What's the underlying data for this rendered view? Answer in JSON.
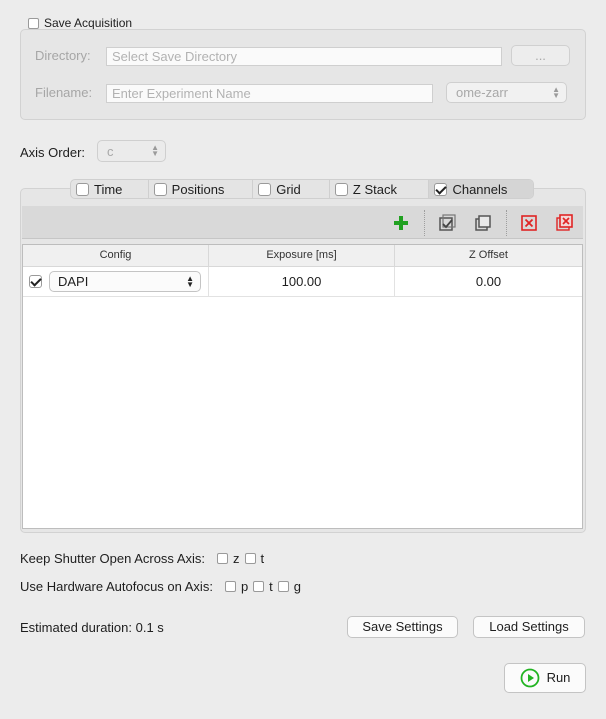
{
  "save_acquisition": {
    "label": "Save Acquisition",
    "checked": false,
    "directory_label": "Directory:",
    "directory_placeholder": "Select Save Directory",
    "browse_label": "...",
    "filename_label": "Filename:",
    "filename_placeholder": "Enter Experiment Name",
    "format_value": "ome-zarr"
  },
  "axis_order": {
    "label": "Axis Order:",
    "value": "c"
  },
  "tabs": [
    {
      "label": "Time",
      "checked": false
    },
    {
      "label": "Positions",
      "checked": false
    },
    {
      "label": "Grid",
      "checked": false
    },
    {
      "label": "Z Stack",
      "checked": false
    },
    {
      "label": "Channels",
      "checked": true
    }
  ],
  "toolbar": {
    "icons": [
      "add-icon",
      "check-all-icon",
      "duplicate-icon",
      "remove-icon",
      "remove-all-icon"
    ],
    "colors": {
      "add": "#21a121",
      "remove": "#e02424"
    }
  },
  "table": {
    "columns": [
      "Config",
      "Exposure [ms]",
      "Z Offset"
    ],
    "rows": [
      {
        "checked": true,
        "config": "DAPI",
        "exposure": "100.00",
        "z_offset": "0.00"
      }
    ]
  },
  "keep_shutter": {
    "label": "Keep Shutter Open Across Axis:",
    "options": [
      "z",
      "t"
    ]
  },
  "hardware_autofocus": {
    "label": "Use Hardware Autofocus on Axis:",
    "options": [
      "p",
      "t",
      "g"
    ]
  },
  "estimated_duration": "Estimated duration: 0.1 s",
  "buttons": {
    "save_settings": "Save Settings",
    "load_settings": "Load Settings",
    "run": "Run"
  },
  "colors": {
    "run_icon": "#22b422"
  }
}
